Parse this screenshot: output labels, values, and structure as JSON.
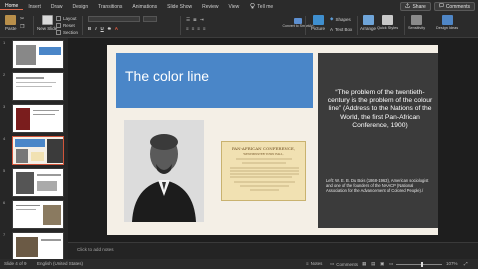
{
  "menu": {
    "tabs": [
      "Home",
      "Insert",
      "Draw",
      "Design",
      "Transitions",
      "Animations",
      "Slide Show",
      "Review",
      "View"
    ],
    "active_tab": "Home",
    "tell_me": "Tell me",
    "share": "Share",
    "comments": "Comments"
  },
  "ribbon": {
    "paste": "Paste",
    "new_slide": "New Slide",
    "layout": "Layout",
    "reset": "Reset",
    "section": "Section",
    "convert": "Convert to SmartArt",
    "picture": "Picture",
    "shapes": "Shapes",
    "text_box": "Text Box",
    "arrange": "Arrange",
    "quick_styles": "Quick Styles",
    "sensitivity": "Sensitivity",
    "design_ideas": "Design Ideas"
  },
  "thumbnails": [
    {
      "num": "1",
      "selected": false
    },
    {
      "num": "2",
      "selected": false
    },
    {
      "num": "3",
      "selected": false
    },
    {
      "num": "4",
      "selected": true
    },
    {
      "num": "5",
      "selected": false
    },
    {
      "num": "6",
      "selected": false
    },
    {
      "num": "7",
      "selected": false
    }
  ],
  "slide": {
    "title": "The color line",
    "quote": "“The problem of the twentieth-century is the problem of the colour line” (Address to the Nations of the World, the first Pan-African Conference, 1900)",
    "caption": "Left: W. E. B. Du Bois (1868-1963), American sociologist and one of the founders of the NAACP (National Association for the Advancement of Colored People)./",
    "program_heading": "PAN-AFRICAN CONFERENCE,",
    "program_sub": "WESTMINSTER TOWN HALL,"
  },
  "notes": {
    "placeholder": "Click to add notes"
  },
  "status": {
    "slide_counter": "Slide 4 of 9",
    "language": "English (United States)",
    "notes": "Notes",
    "comments": "Comments",
    "zoom": "107%",
    "zoom_fraction": 0.55
  },
  "colors": {
    "title_blue": "#4a86c8",
    "panel_dark": "#3b3b3b",
    "selection": "#d1543a"
  }
}
